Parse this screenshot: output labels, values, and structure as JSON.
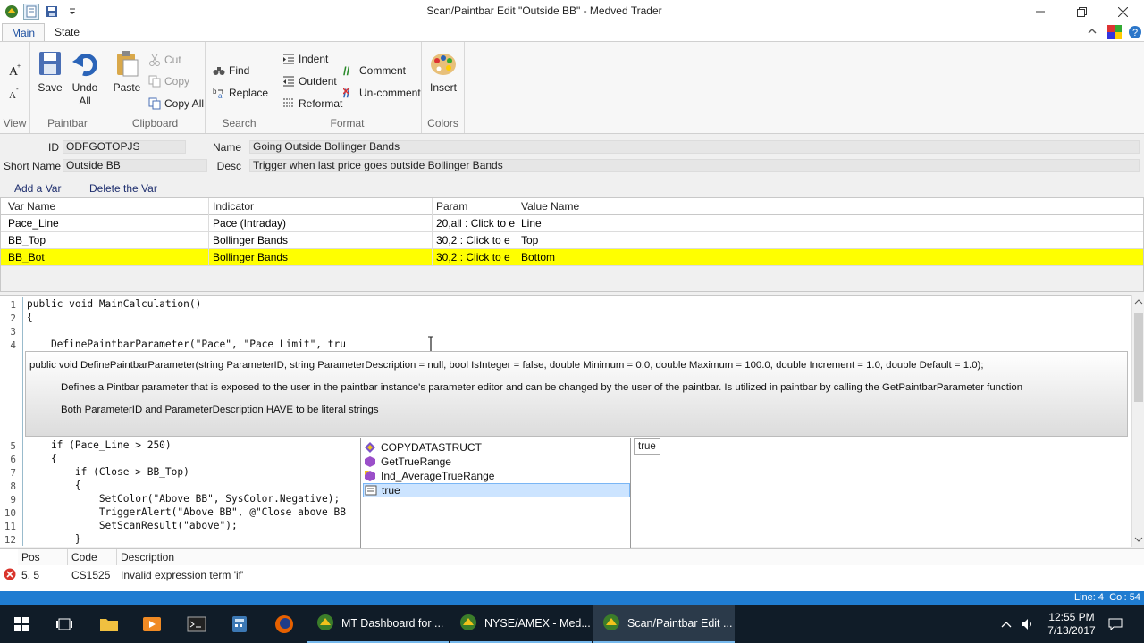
{
  "window": {
    "title": "Scan/Paintbar Edit \"Outside BB\" - Medved Trader"
  },
  "tabs": [
    {
      "label": "Main"
    },
    {
      "label": "State"
    }
  ],
  "ribbon": {
    "view": {
      "label": "View"
    },
    "paintbar": {
      "label": "Paintbar",
      "save": "Save",
      "undo_all": "Undo All"
    },
    "clipboard": {
      "label": "Clipboard",
      "paste": "Paste",
      "cut": "Cut",
      "copy": "Copy",
      "copy_all": "Copy All"
    },
    "search": {
      "label": "Search",
      "find": "Find",
      "replace": "Replace"
    },
    "format": {
      "label": "Format",
      "indent": "Indent",
      "outdent": "Outdent",
      "reformat": "Reformat",
      "comment": "Comment",
      "uncomment": "Un-comment"
    },
    "colors": {
      "label": "Colors",
      "insert": "Insert"
    }
  },
  "props": {
    "id_label": "ID",
    "id_value": "ODFGOTOPJS",
    "name_label": "Name",
    "name_value": "Going Outside Bollinger Bands",
    "short_label": "Short Name",
    "short_value": "Outside BB",
    "desc_label": "Desc",
    "desc_value": "Trigger when last price goes outside Bollinger Bands"
  },
  "vars": {
    "add": "Add a Var",
    "delete": "Delete the Var",
    "headers": [
      "Var Name",
      "Indicator",
      "Param",
      "Value Name"
    ],
    "rows": [
      [
        "Pace_Line",
        "Pace (Intraday)",
        "20,all : Click to e",
        "Line"
      ],
      [
        "BB_Top",
        "Bollinger Bands",
        "30,2 : Click to e",
        "Top"
      ],
      [
        "BB_Bot",
        "Bollinger Bands",
        "30,2 : Click to e",
        "Bottom"
      ]
    ],
    "selected_index": 2
  },
  "editor": {
    "lines_top": [
      {
        "n": "1",
        "t": "public void MainCalculation()"
      },
      {
        "n": "2",
        "t": "{"
      },
      {
        "n": "3",
        "t": ""
      },
      {
        "n": "4",
        "t": "    DefinePaintbarParameter(\"Pace\", \"Pace Limit\", tru"
      }
    ],
    "lines_bottom": [
      {
        "n": "5",
        "t": "    if (Pace_Line > 250)"
      },
      {
        "n": "6",
        "t": "    {"
      },
      {
        "n": "7",
        "t": "        if (Close > BB_Top)"
      },
      {
        "n": "8",
        "t": "        {"
      },
      {
        "n": "9",
        "t": "            SetColor(\"Above BB\", SysColor.Negative);"
      },
      {
        "n": "10",
        "t": "            TriggerAlert(\"Above BB\", @\"Close above BB"
      },
      {
        "n": "11",
        "t": "            SetScanResult(\"above\");"
      },
      {
        "n": "12",
        "t": "        }"
      }
    ]
  },
  "tooltip": {
    "signature": "public void DefinePaintbarParameter(string ParameterID, string ParameterDescription = null, bool IsInteger = false, double Minimum = 0.0, double Maximum = 100.0, double Increment = 1.0, double Default = 1.0);",
    "line1": "Defines a Pintbar parameter that is exposed to the user in the paintbar instance's parameter editor and can be changed by the user of the paintbar. Is utilized in paintbar by calling the GetPaintbarParameter function",
    "line2": "Both ParameterID and ParameterDescription HAVE to be literal strings"
  },
  "autocomplete": {
    "items": [
      "COPYDATASTRUCT",
      "GetTrueRange",
      "Ind_AverageTrueRange",
      "true"
    ],
    "selected_index": 3,
    "hint": "true"
  },
  "errors": {
    "headers": [
      "Pos",
      "Code",
      "Description"
    ],
    "rows": [
      {
        "pos": "5, 5",
        "code": "CS1525",
        "desc": "Invalid expression term 'if'"
      }
    ]
  },
  "status": {
    "text": "Line: 4  Col: 54"
  },
  "taskbar": {
    "apps": [
      "MT Dashboard for ...",
      "NYSE/AMEX - Med...",
      "Scan/Paintbar Edit ..."
    ],
    "time": "12:55 PM",
    "date": "7/13/2017"
  },
  "colors": {
    "selected_row": "#ffff00",
    "status_bar": "#1f7cd1",
    "error": "#d9342b"
  }
}
